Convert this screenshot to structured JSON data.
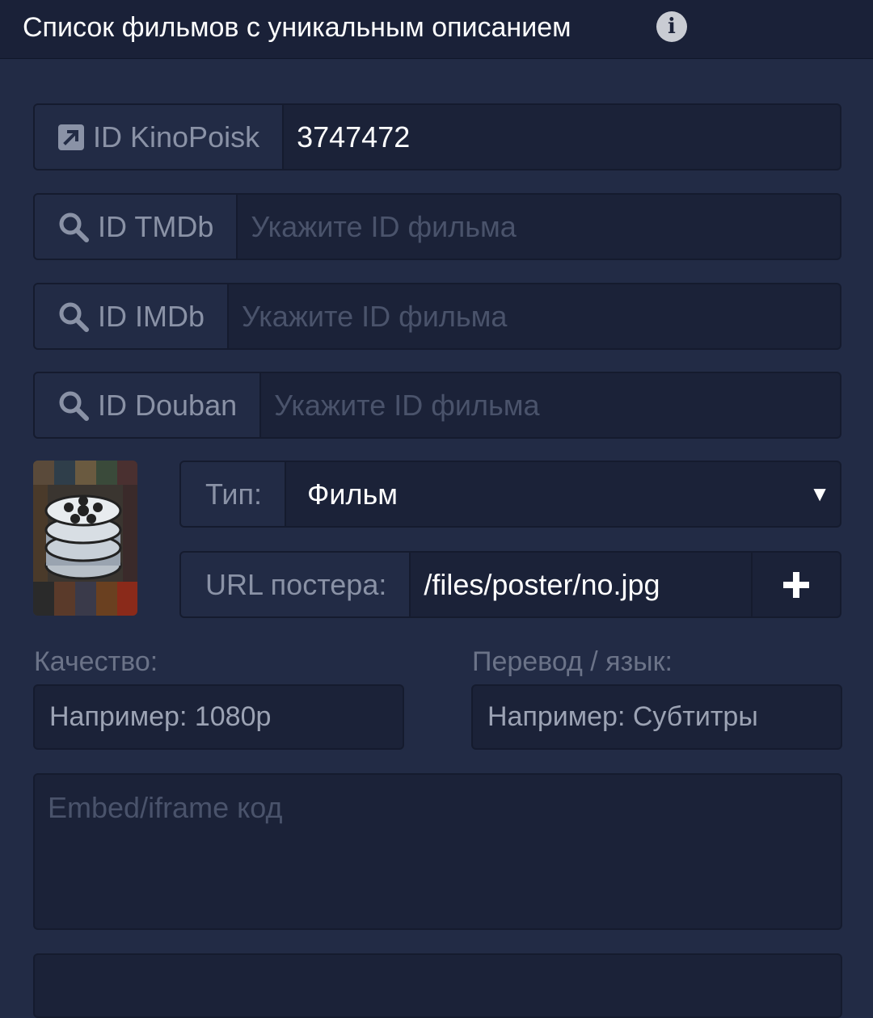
{
  "header": {
    "title": "Список фильмов с уникальным описанием",
    "info_icon": "info-icon"
  },
  "ids": [
    {
      "label": "ID KinoPoisk",
      "icon": "external-link-icon",
      "value": "3747472",
      "placeholder": ""
    },
    {
      "label": "ID TMDb",
      "icon": "search-icon",
      "value": "",
      "placeholder": "Укажите ID фильма"
    },
    {
      "label": "ID IMDb",
      "icon": "search-icon",
      "value": "",
      "placeholder": "Укажите ID фильма"
    },
    {
      "label": "ID Douban",
      "icon": "search-icon",
      "value": "",
      "placeholder": "Укажите ID фильма"
    }
  ],
  "type": {
    "label": "Тип:",
    "value": "Фильм"
  },
  "poster": {
    "label": "URL постера:",
    "value": "/files/poster/no.jpg",
    "add_icon": "plus-icon"
  },
  "quality": {
    "label": "Качество:",
    "placeholder": "Например: 1080p"
  },
  "translation": {
    "label": "Перевод / язык:",
    "placeholder": "Например: Субтитры"
  },
  "embed": {
    "placeholder": "Embed/iframe код"
  }
}
